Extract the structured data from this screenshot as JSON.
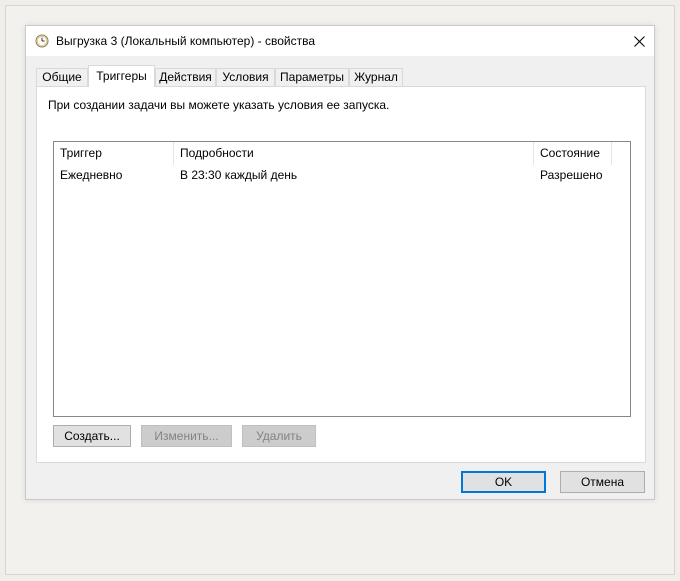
{
  "window": {
    "title": "Выгрузка 3 (Локальный компьютер) - свойства",
    "close_glyph": "✕"
  },
  "tabs": [
    {
      "label": "Общие",
      "active": false
    },
    {
      "label": "Триггеры",
      "active": true
    },
    {
      "label": "Действия",
      "active": false
    },
    {
      "label": "Условия",
      "active": false
    },
    {
      "label": "Параметры",
      "active": false
    },
    {
      "label": "Журнал",
      "active": false
    }
  ],
  "panel": {
    "info_text": "При создании задачи вы можете указать условия ее запуска."
  },
  "triggers_table": {
    "columns": [
      "Триггер",
      "Подробности",
      "Состояние"
    ],
    "rows": [
      {
        "trigger": "Ежедневно",
        "details": "В 23:30 каждый день",
        "status": "Разрешено"
      }
    ]
  },
  "panel_buttons": {
    "create": "Создать...",
    "edit": "Изменить...",
    "delete": "Удалить"
  },
  "footer_buttons": {
    "ok": "OK",
    "cancel": "Отмена"
  },
  "colors": {
    "accent": "#0078d7",
    "disabled_text": "#838383"
  },
  "icons": {
    "title_icon": "task-scheduler-clock-icon",
    "close": "close-icon"
  }
}
